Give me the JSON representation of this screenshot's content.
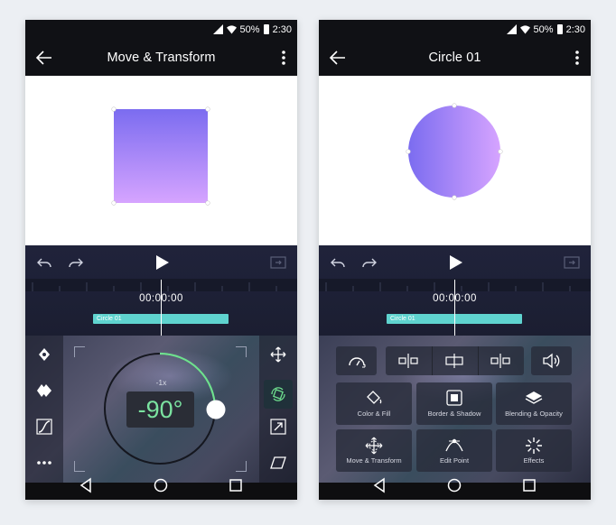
{
  "status_bar": {
    "battery": "50%",
    "time": "2:30"
  },
  "left_screen": {
    "title": "Move & Transform",
    "timecode": "00:00:00",
    "track_label": "Circle 01",
    "rotation_speed": "-1x",
    "rotation_value": "-90°"
  },
  "right_screen": {
    "title": "Circle 01",
    "timecode": "00:00:00",
    "track_label": "Circle 01",
    "tools": [
      {
        "label": "Color & Fill",
        "icon": "paint-bucket-icon"
      },
      {
        "label": "Border & Shadow",
        "icon": "border-shadow-icon"
      },
      {
        "label": "Blending & Opacity",
        "icon": "blending-icon"
      },
      {
        "label": "Move & Transform",
        "icon": "move-transform-icon"
      },
      {
        "label": "Edit Point",
        "icon": "edit-point-icon"
      },
      {
        "label": "Effects",
        "icon": "effects-icon"
      }
    ]
  },
  "colors": {
    "accent_green": "#6fe08f",
    "track_teal": "#5fd3cf",
    "shape_gradient_start": "#7b6cf0",
    "shape_gradient_end": "#d6a4ff"
  }
}
